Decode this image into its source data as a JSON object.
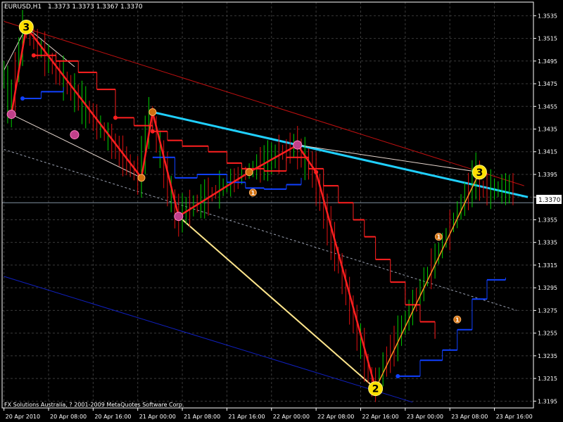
{
  "header": {
    "symbol": "EURUSD,H1",
    "ohlc": "1.3373 1.3373 1.3367 1.3370"
  },
  "footer": {
    "copyright": "FX Solutions Australia, ? 2001-2009 MetaQuotes Software Corp."
  },
  "price_label": "1.3370",
  "colors": {
    "background": "#000000",
    "grid": "#3a3a3a",
    "axis": "#ffffff",
    "bull": "#00d000",
    "bear": "#e01010",
    "zigzag_main": "#ff2020",
    "zigzag_orange": "#ff9020",
    "cyan_trend": "#20d0ff",
    "yellow_line": "#ffe68c",
    "blue_channel": "#1020c0",
    "red_channel": "#c01010",
    "stop_bear": "#ff2020",
    "stop_bull": "#1040ff"
  },
  "chart_data": {
    "type": "candlestick",
    "symbol": "EURUSD",
    "timeframe": "H1",
    "grid": true,
    "yticks": [
      1.3535,
      1.3515,
      1.3495,
      1.3475,
      1.3455,
      1.3435,
      1.3415,
      1.3395,
      1.3375,
      1.3355,
      1.3335,
      1.3315,
      1.3295,
      1.3275,
      1.3255,
      1.3235,
      1.3215,
      1.3195
    ],
    "ylim": [
      1.3189,
      1.3547
    ],
    "xtick_labels": [
      "20 Apr 2010",
      "20 Apr 08:00",
      "20 Apr 16:00",
      "21 Apr 00:00",
      "21 Apr 08:00",
      "21 Apr 16:00",
      "22 Apr 00:00",
      "22 Apr 08:00",
      "22 Apr 16:00",
      "23 Apr 00:00",
      "23 Apr 08:00",
      "23 Apr 16:00"
    ],
    "current_price": 1.337,
    "zigzag_points": [
      {
        "bar": 2,
        "price": 1.3448,
        "label": ""
      },
      {
        "bar": 6,
        "price": 1.3525,
        "label": "3"
      },
      {
        "bar": 37,
        "price": 1.3392,
        "label": ""
      },
      {
        "bar": 40,
        "price": 1.345,
        "label": ""
      },
      {
        "bar": 47,
        "price": 1.3358,
        "label": ""
      },
      {
        "bar": 66,
        "price": 1.3397,
        "label": ""
      },
      {
        "bar": 79,
        "price": 1.3421,
        "label": ""
      },
      {
        "bar": 84,
        "price": 1.3397,
        "label": ""
      },
      {
        "bar": 100,
        "price": 1.3206,
        "label": "2"
      },
      {
        "bar": 128,
        "price": 1.3397,
        "label": "3"
      }
    ],
    "markers": [
      {
        "bar": 2,
        "price": 1.3448,
        "label": "",
        "style": "pink"
      },
      {
        "bar": 6,
        "price": 1.3525,
        "label": "3",
        "style": "yellow"
      },
      {
        "bar": 19,
        "price": 1.343,
        "label": "",
        "style": "pink"
      },
      {
        "bar": 37,
        "price": 1.3392,
        "label": "",
        "style": "orange"
      },
      {
        "bar": 40,
        "price": 1.345,
        "label": "",
        "style": "orange"
      },
      {
        "bar": 47,
        "price": 1.3358,
        "label": "",
        "style": "pink"
      },
      {
        "bar": 66,
        "price": 1.3397,
        "label": "",
        "style": "orange"
      },
      {
        "bar": 67,
        "price": 1.3379,
        "label": "1",
        "style": "orange"
      },
      {
        "bar": 79,
        "price": 1.3421,
        "label": "",
        "style": "pink"
      },
      {
        "bar": 100,
        "price": 1.3206,
        "label": "2",
        "style": "yellow"
      },
      {
        "bar": 117,
        "price": 1.334,
        "label": "1",
        "style": "orange"
      },
      {
        "bar": 122,
        "price": 1.3267,
        "label": "1",
        "style": "orange"
      },
      {
        "bar": 128,
        "price": 1.3397,
        "label": "3",
        "style": "yellow"
      }
    ],
    "trendlines": [
      {
        "name": "",
        "role": "red-channel",
        "p1": {
          "bar": 0,
          "price": 1.353
        },
        "p2": {
          "bar": 140,
          "price": 1.3385
        }
      },
      {
        "name": "",
        "role": "cyan",
        "p1": {
          "bar": 40,
          "price": 1.345
        },
        "p2": {
          "bar": 141,
          "price": 1.3375
        }
      },
      {
        "name": "",
        "role": "white-dotted",
        "p1": {
          "bar": 0,
          "price": 1.3417
        },
        "p2": {
          "bar": 138,
          "price": 1.3275
        }
      },
      {
        "name": "",
        "role": "yellow",
        "p1": {
          "bar": 47,
          "price": 1.3358
        },
        "p2": {
          "bar": 100,
          "price": 1.3206
        }
      },
      {
        "name": "",
        "role": "blue",
        "p1": {
          "bar": 0,
          "price": 1.3305
        },
        "p2": {
          "bar": 110,
          "price": 1.3194
        }
      },
      {
        "name": "",
        "role": "white-thin",
        "p1": {
          "bar": 0,
          "price": 1.3487
        },
        "p2": {
          "bar": 6,
          "price": 1.3525
        }
      },
      {
        "name": "",
        "role": "white-thin",
        "p1": {
          "bar": 2,
          "price": 1.3448
        },
        "p2": {
          "bar": 37,
          "price": 1.3392
        }
      },
      {
        "name": "",
        "role": "white-thin",
        "p1": {
          "bar": 6,
          "price": 1.3525
        },
        "p2": {
          "bar": 19,
          "price": 1.349
        }
      },
      {
        "name": "",
        "role": "white-thin",
        "p1": {
          "bar": 79,
          "price": 1.3421
        },
        "p2": {
          "bar": 128,
          "price": 1.3397
        }
      }
    ],
    "stop_lines": {
      "red": [
        [
          8,
          1.35
        ],
        [
          14,
          1.3495
        ],
        [
          20,
          1.3485
        ],
        [
          25,
          1.347
        ],
        [
          30,
          1.3445
        ],
        [
          35,
          1.3438
        ],
        [
          40,
          1.3433
        ],
        [
          44,
          1.3425
        ],
        [
          48,
          1.342
        ],
        [
          55,
          1.3415
        ],
        [
          60,
          1.3405
        ],
        [
          64,
          1.34
        ],
        [
          70,
          1.3398
        ],
        [
          76,
          1.341
        ],
        [
          82,
          1.34
        ],
        [
          86,
          1.3385
        ],
        [
          90,
          1.337
        ],
        [
          94,
          1.3355
        ],
        [
          97,
          1.334
        ],
        [
          100,
          1.332
        ],
        [
          104,
          1.33
        ],
        [
          108,
          1.328
        ],
        [
          112,
          1.3265
        ],
        [
          116,
          1.325
        ]
      ],
      "blue": [
        [
          5,
          1.3462
        ],
        [
          10,
          1.3468
        ],
        [
          16,
          1.3472
        ],
        [
          40,
          1.341
        ],
        [
          46,
          1.3392
        ],
        [
          52,
          1.3395
        ],
        [
          60,
          1.3388
        ],
        [
          65,
          1.3383
        ],
        [
          70,
          1.3382
        ],
        [
          76,
          1.3386
        ],
        [
          80,
          1.3392
        ],
        [
          106,
          1.3217
        ],
        [
          112,
          1.3231
        ],
        [
          118,
          1.324
        ],
        [
          122,
          1.3258
        ],
        [
          126,
          1.3285
        ],
        [
          130,
          1.3302
        ],
        [
          135,
          1.3304
        ]
      ]
    }
  }
}
